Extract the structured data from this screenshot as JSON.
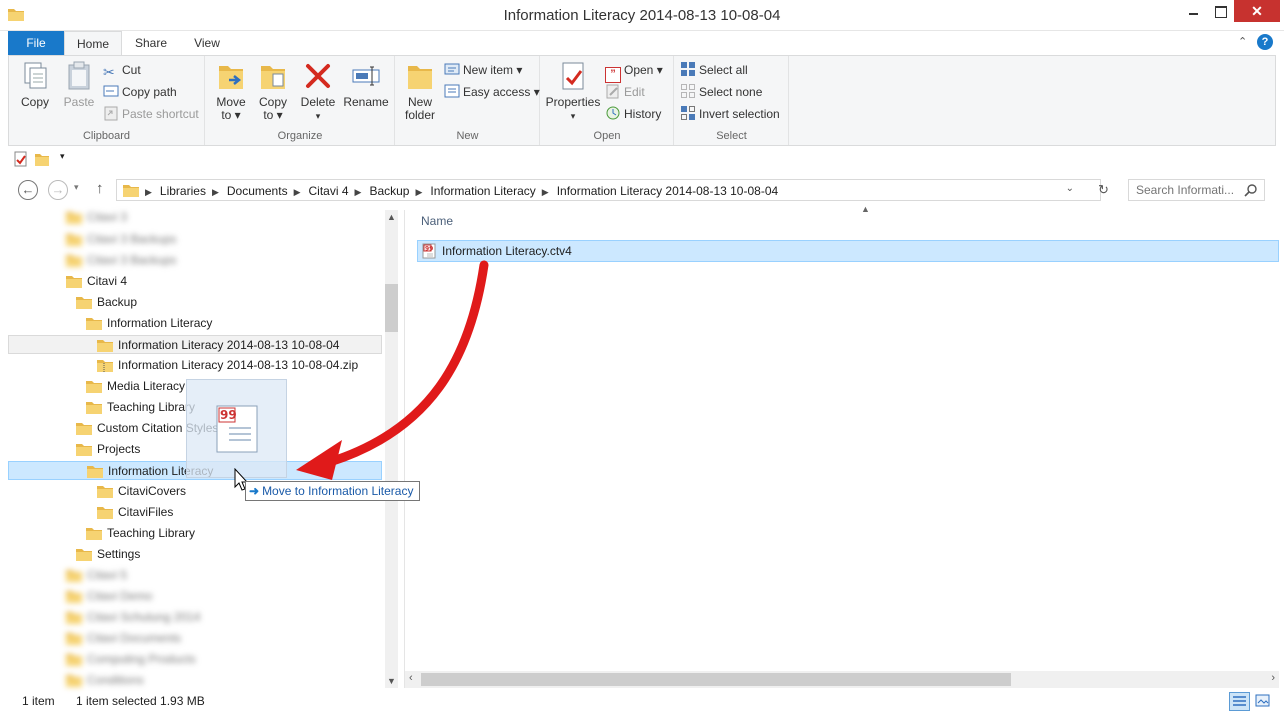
{
  "window": {
    "title": "Information Literacy 2014-08-13 10-08-04",
    "close_glyph": "✕"
  },
  "tabs": {
    "file": "File",
    "home": "Home",
    "share": "Share",
    "view": "View"
  },
  "ribbon": {
    "clipboard": {
      "label": "Clipboard",
      "copy": "Copy",
      "paste": "Paste",
      "cut": "Cut",
      "copy_path": "Copy path",
      "paste_shortcut": "Paste shortcut"
    },
    "organize": {
      "label": "Organize",
      "move_to": "Move",
      "move_to_2": "to ▾",
      "copy_to": "Copy",
      "copy_to_2": "to ▾",
      "delete": "Delete",
      "rename": "Rename"
    },
    "new": {
      "label": "New",
      "new_folder": "New",
      "new_folder_2": "folder",
      "new_item": "New item ▾",
      "easy_access": "Easy access ▾"
    },
    "open": {
      "label": "Open",
      "properties": "Properties",
      "open": "Open ▾",
      "edit": "Edit",
      "history": "History"
    },
    "select": {
      "label": "Select",
      "select_all": "Select all",
      "select_none": "Select none",
      "invert": "Invert selection"
    }
  },
  "address": {
    "crumbs": [
      "Libraries",
      "Documents",
      "Citavi 4",
      "Backup",
      "Information Literacy",
      "Information Literacy 2014-08-13 10-08-04"
    ],
    "search_placeholder": "Search Informati..."
  },
  "tree": [
    {
      "label": "Citavi 3"
    },
    {
      "label": "Citavi 3 Backups"
    },
    {
      "label": "Citavi 3 Backups"
    },
    {
      "label": "Citavi 4"
    },
    {
      "label": "Backup"
    },
    {
      "label": "Information Literacy"
    },
    {
      "label": "Information Literacy 2014-08-13 10-08-04"
    },
    {
      "label": "Information Literacy 2014-08-13 10-08-04.zip"
    },
    {
      "label": "Media Literacy"
    },
    {
      "label": "Teaching Library"
    },
    {
      "label": "Custom Citation Styles"
    },
    {
      "label": "Projects"
    },
    {
      "label": "Information Literacy"
    },
    {
      "label": "CitaviCovers"
    },
    {
      "label": "CitaviFiles"
    },
    {
      "label": "Teaching Library"
    },
    {
      "label": "Settings"
    },
    {
      "label": "Citavi 5"
    },
    {
      "label": "Citavi Demo"
    },
    {
      "label": "Citavi Schulung 2014"
    },
    {
      "label": "Citavi Documents"
    },
    {
      "label": "Computing Products"
    },
    {
      "label": "Conditions"
    }
  ],
  "content": {
    "column_name": "Name",
    "files": [
      {
        "name": "Information Literacy.ctv4"
      }
    ]
  },
  "drag": {
    "tooltip": "Move to Information Literacy",
    "plus": "➜"
  },
  "status": {
    "count": "1 item",
    "selected": "1 item selected  1.93 MB"
  }
}
